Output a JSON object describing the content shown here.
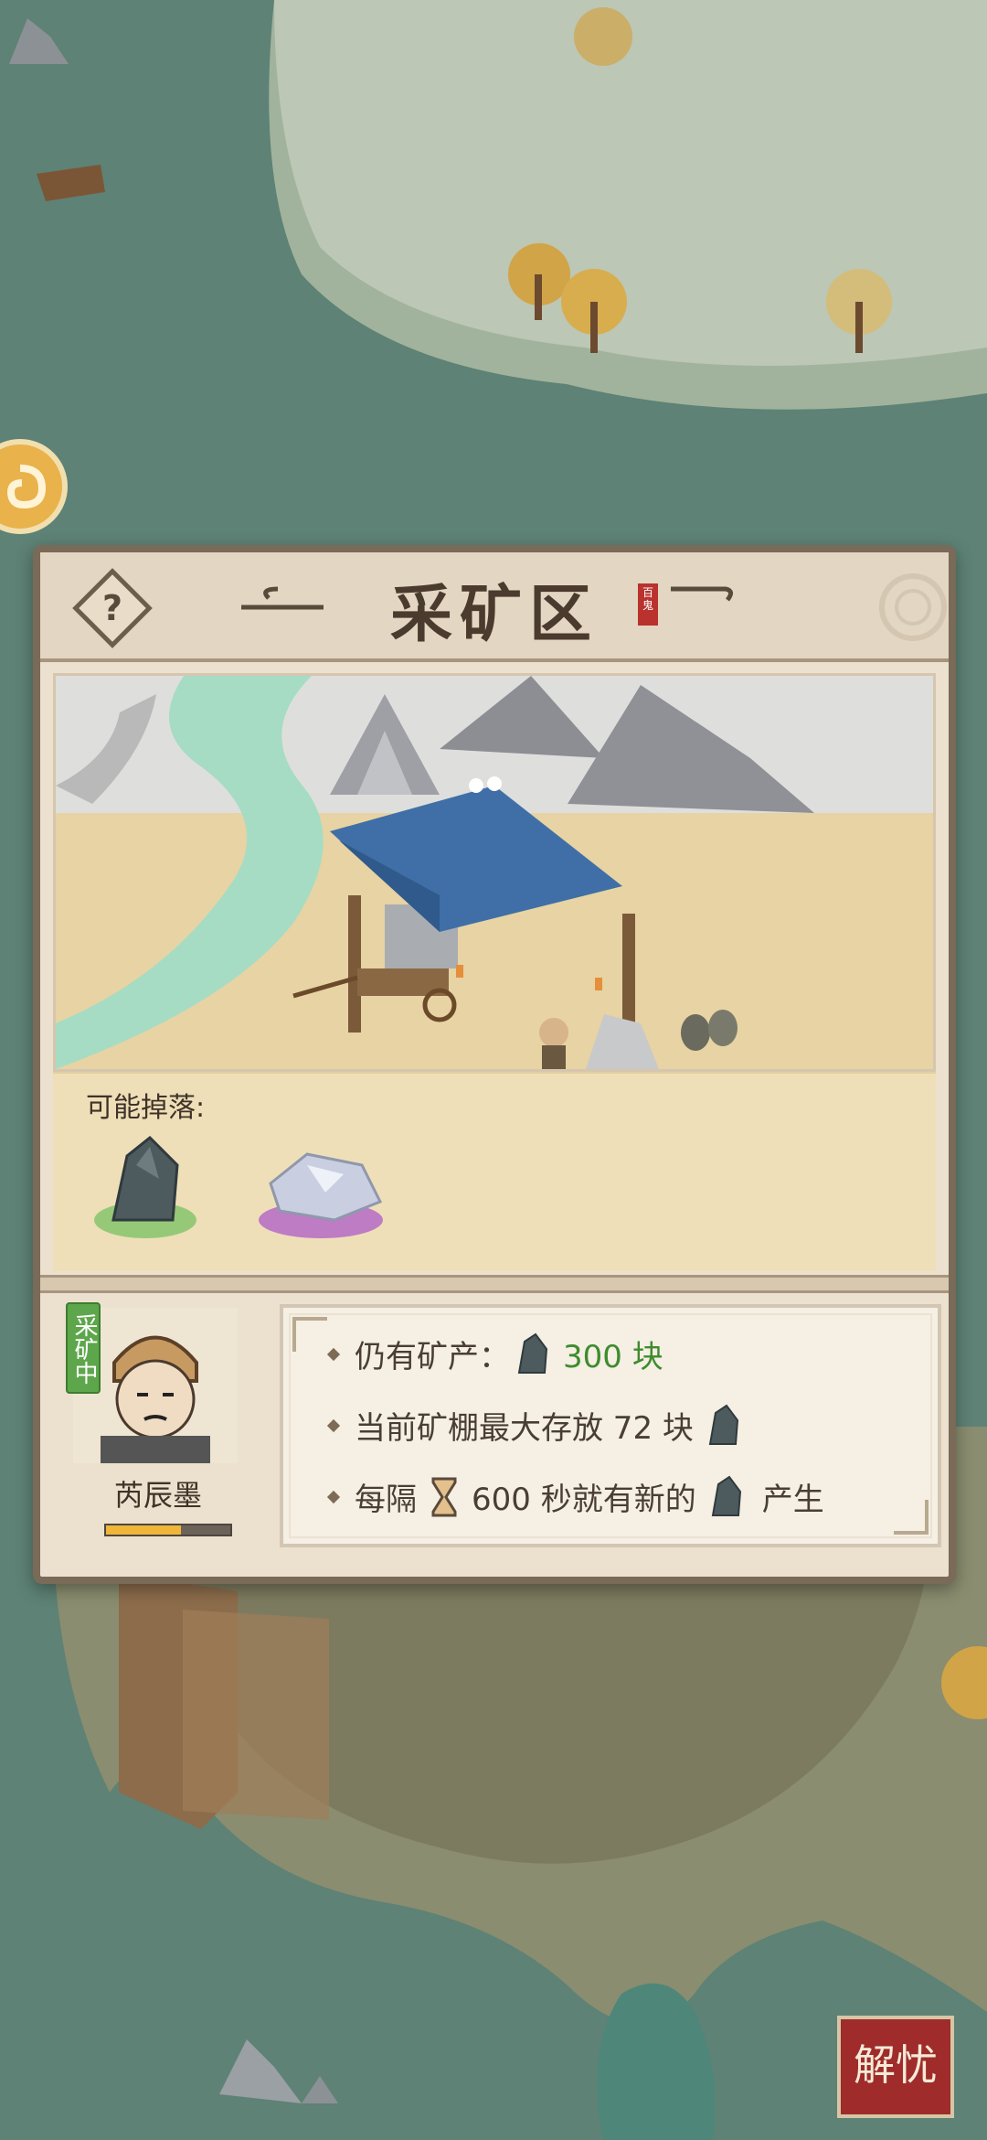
{
  "dialog": {
    "title": "采矿区",
    "title_seal": "百鬼",
    "help_symbol": "?",
    "drops_label": "可能掉落:",
    "drops": [
      {
        "name": "dark-ore",
        "color": "#4e5b5e"
      },
      {
        "name": "silver-ore",
        "color": "#c9cfe0"
      }
    ]
  },
  "worker": {
    "status": "采矿中",
    "name": "芮辰墨",
    "progress": 0.6
  },
  "info": {
    "line1_prefix": "仍有矿产：",
    "line1_value": "300 块",
    "line2_text": "当前矿棚最大存放 72 块",
    "line3_prefix": "每隔",
    "line3_mid": "600 秒就有新的",
    "line3_suffix": "产生"
  },
  "corner_button": {
    "label": "解忧"
  },
  "colors": {
    "map_green": "#5d7f73",
    "accent": "#f0b63a",
    "value_green": "#3f8b2e"
  }
}
